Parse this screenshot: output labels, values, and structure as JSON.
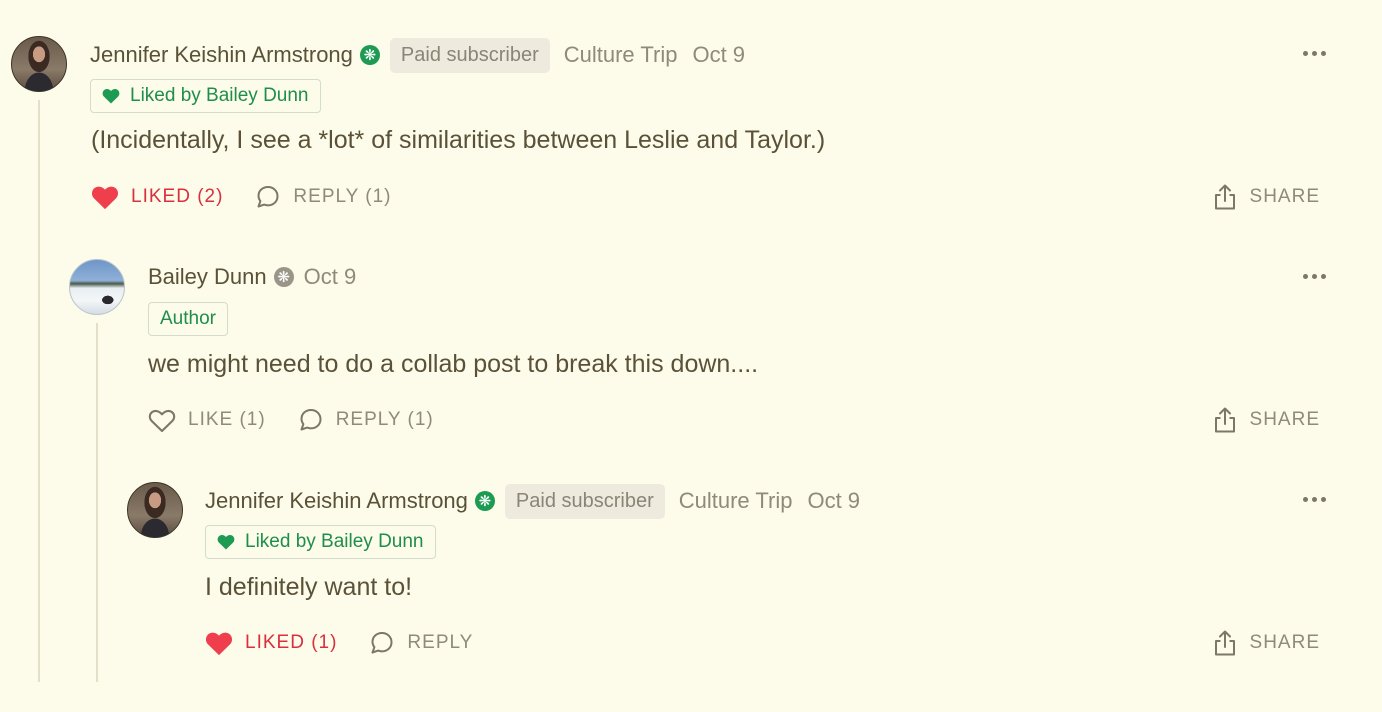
{
  "comments": [
    {
      "author": "Jennifer Keishin Armstrong",
      "badge_icon": "green-subscriber-badge-icon",
      "subscriber_label": "Paid subscriber",
      "publication": "Culture Trip",
      "date": "Oct 9",
      "tag": "Liked by Bailey Dunn",
      "text": "(Incidentally, I see a *lot* of similarities between Leslie and Taylor.)",
      "like_label": "LIKED (2)",
      "liked": true,
      "reply_label": "REPLY (1)",
      "share_label": "SHARE"
    },
    {
      "author": "Bailey Dunn",
      "badge_icon": "gray-author-badge-icon",
      "date": "Oct 9",
      "tag": "Author",
      "text": "we might need to do a collab post to break this down....",
      "like_label": "LIKE (1)",
      "liked": false,
      "reply_label": "REPLY (1)",
      "share_label": "SHARE"
    },
    {
      "author": "Jennifer Keishin Armstrong",
      "badge_icon": "green-subscriber-badge-icon",
      "subscriber_label": "Paid subscriber",
      "publication": "Culture Trip",
      "date": "Oct 9",
      "tag": "Liked by Bailey Dunn",
      "text": "I definitely want to!",
      "like_label": "LIKED (1)",
      "liked": true,
      "reply_label": "REPLY",
      "share_label": "SHARE"
    }
  ],
  "colors": {
    "background": "#fdfbe9",
    "liked_red": "#d9303e",
    "tag_green": "#1e8f4a",
    "muted_text": "#8f8a7a"
  }
}
